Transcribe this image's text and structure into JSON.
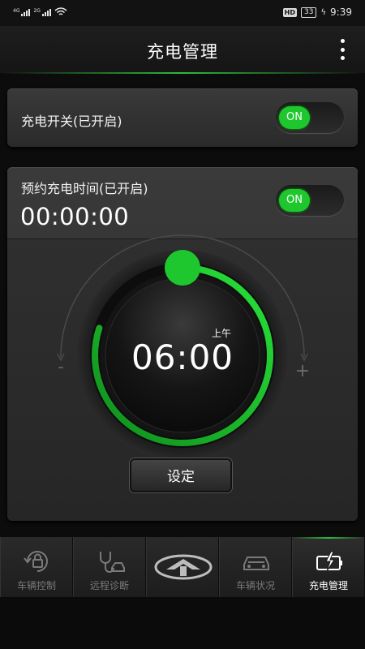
{
  "status_bar": {
    "signal1_tag": "4G",
    "signal2_tag": "2G",
    "hd": "HD",
    "battery": "33",
    "time": "9:39"
  },
  "header": {
    "title": "充电管理",
    "more_icon": "more-vertical-icon"
  },
  "charging_switch": {
    "label": "充电开关(已开启)",
    "toggle": "ON"
  },
  "schedule": {
    "label": "预约充电时间(已开启)",
    "time": "00:00:00",
    "toggle": "ON"
  },
  "dial": {
    "period": "上午",
    "time": "06:00",
    "minus": "-",
    "plus": "+",
    "progress": 0.8
  },
  "set_button": "设定",
  "nav": {
    "items": [
      {
        "label": "车辆控制",
        "icon": "lock-refresh-icon",
        "active": false
      },
      {
        "label": "远程诊断",
        "icon": "stethoscope-car-icon",
        "active": false
      },
      {
        "label": "",
        "icon": "brand-logo-icon",
        "active": false
      },
      {
        "label": "车辆状况",
        "icon": "car-icon",
        "active": false
      },
      {
        "label": "充电管理",
        "icon": "battery-charge-icon",
        "active": true
      }
    ]
  },
  "colors": {
    "accent_green": "#1ec72e"
  }
}
